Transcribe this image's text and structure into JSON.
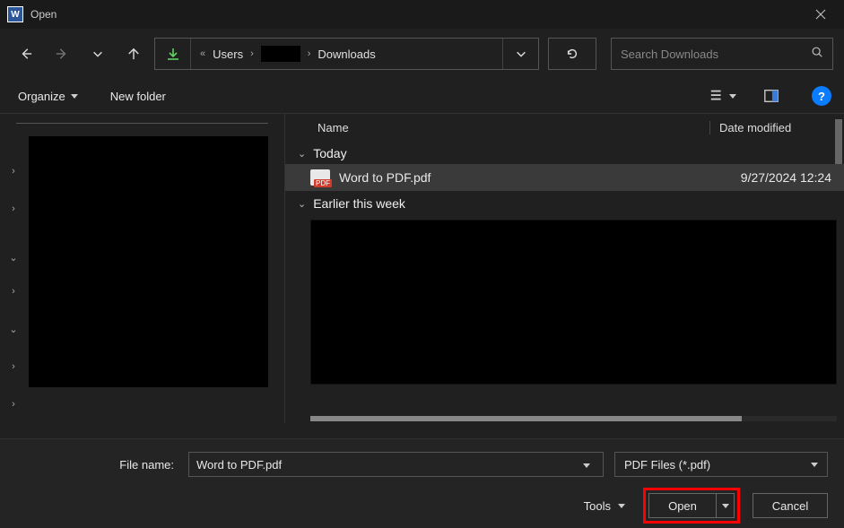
{
  "title": "Open",
  "breadcrumb": {
    "items": [
      "Users",
      "",
      "Downloads"
    ]
  },
  "search": {
    "placeholder": "Search Downloads"
  },
  "toolbar": {
    "organize": "Organize",
    "newfolder": "New folder"
  },
  "columns": {
    "name": "Name",
    "date": "Date modified"
  },
  "groups": [
    {
      "label": "Today"
    },
    {
      "label": "Earlier this week"
    }
  ],
  "files": [
    {
      "name": "Word to PDF.pdf",
      "date": "9/27/2024 12:24"
    }
  ],
  "bottom": {
    "filename_label": "File name:",
    "filename_value": "Word to PDF.pdf",
    "filter": "PDF Files (*.pdf)",
    "tools": "Tools",
    "open": "Open",
    "cancel": "Cancel"
  }
}
